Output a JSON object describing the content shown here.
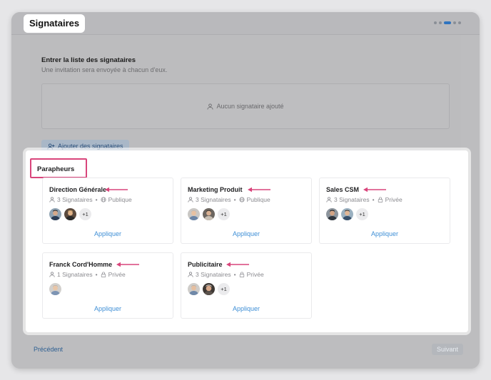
{
  "window": {
    "title": "Signataires"
  },
  "steps": {
    "total": 5,
    "active_index": 3
  },
  "signers_section": {
    "title": "Entrer la liste des signataires",
    "subtitle": "Une invitation sera envoyée à chacun d'eux.",
    "empty_text": "Aucun signataire ajouté",
    "add_button": "Ajouter des signataires"
  },
  "parapheurs": {
    "title": "Parapheurs",
    "cards": [
      {
        "name": "Direction Générale",
        "count": "3 Signataires",
        "visibility": "Publique",
        "visibility_icon": "globe-icon",
        "more": "+1",
        "apply": "Appliquer"
      },
      {
        "name": "Marketing Produit",
        "count": "3 Signataires",
        "visibility": "Publique",
        "visibility_icon": "globe-icon",
        "more": "+1",
        "apply": "Appliquer"
      },
      {
        "name": "Sales CSM",
        "count": "3 Signataires",
        "visibility": "Privée",
        "visibility_icon": "lock-icon",
        "more": "+1",
        "apply": "Appliquer"
      },
      {
        "name": "Franck Cord'Homme",
        "count": "1 Signataires",
        "visibility": "Privée",
        "visibility_icon": "lock-icon",
        "more": "",
        "apply": "Appliquer"
      },
      {
        "name": "Publicitaire",
        "count": "3 Signataires",
        "visibility": "Privée",
        "visibility_icon": "lock-icon",
        "more": "+1",
        "apply": "Appliquer"
      }
    ]
  },
  "footer": {
    "prev": "Précédent",
    "next": "Suivant"
  },
  "colors": {
    "accent": "#3f8fd6",
    "highlight": "#d9457b",
    "arrow": "#d9457b"
  }
}
